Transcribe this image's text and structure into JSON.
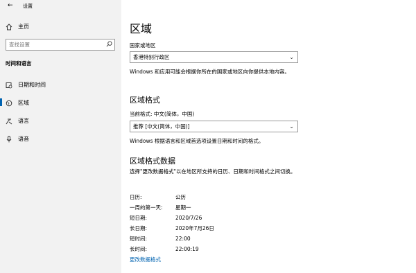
{
  "app": {
    "title": "设置"
  },
  "sidebar": {
    "home": "主页",
    "search_placeholder": "查找设置",
    "section": "时间和语言",
    "items": [
      {
        "label": "日期和时间",
        "icon": "calendar-clock-icon"
      },
      {
        "label": "区域",
        "icon": "globe-icon",
        "active": true
      },
      {
        "label": "语言",
        "icon": "language-icon"
      },
      {
        "label": "语音",
        "icon": "microphone-icon"
      }
    ]
  },
  "main": {
    "title": "区域",
    "country_label": "国家或地区",
    "country_value": "香港特别行政区",
    "country_desc": "Windows 和应用可能会根据你所在的国家或地区向你提供本地内容。",
    "format_heading": "区域格式",
    "current_format_label": "当前格式: 中文(简体，中国)",
    "format_value": "推荐 [中文(简体，中国)]",
    "format_desc": "Windows 根据语言和区域首选项设置日期和时间的格式。",
    "data_heading": "区域格式数据",
    "data_desc": "选择\"更改数据格式\"以在地区所支持的日历、日期和时间格式之间切换。",
    "rows": [
      {
        "k": "日历:",
        "v": "公历"
      },
      {
        "k": "一周的第一天:",
        "v": "星期一"
      },
      {
        "k": "短日期:",
        "v": "2020/7/26"
      },
      {
        "k": "长日期:",
        "v": "2020年7月26日"
      },
      {
        "k": "短时间:",
        "v": "22:00"
      },
      {
        "k": "长时间:",
        "v": "22:00:19"
      }
    ],
    "change_link": "更改数据格式"
  },
  "colors": {
    "accent": "#0063b1",
    "sidebar_bg": "#f2f2f2"
  }
}
